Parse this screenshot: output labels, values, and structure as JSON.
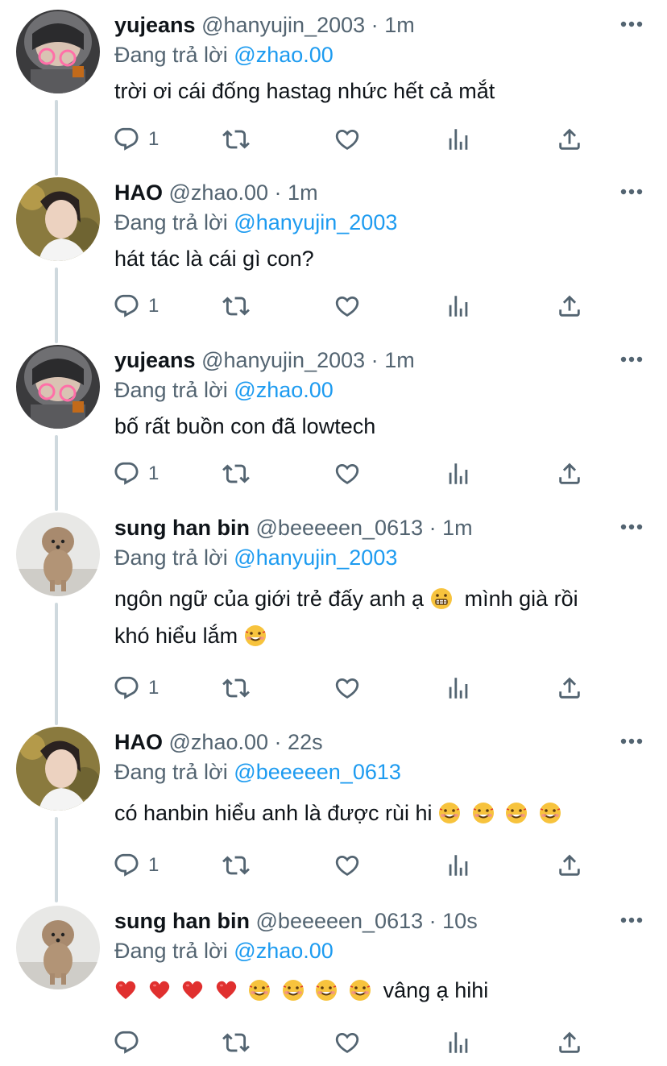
{
  "tweets": [
    {
      "name": "yujeans",
      "handle": "@hanyujin_2003",
      "dot": "·",
      "time": "1m",
      "reply_prefix": "Đang trả lời",
      "reply_to": "@zhao.00",
      "text": "trời ơi cái đống hastag nhức hết cả mắt",
      "reply_count": "1"
    },
    {
      "name": "HAO",
      "handle": "@zhao.00",
      "dot": "·",
      "time": "1m",
      "reply_prefix": "Đang trả lời",
      "reply_to": "@hanyujin_2003",
      "text": "hát tác là cái gì con?",
      "reply_count": "1"
    },
    {
      "name": "yujeans",
      "handle": "@hanyujin_2003",
      "dot": "·",
      "time": "1m",
      "reply_prefix": "Đang trả lời",
      "reply_to": "@zhao.00",
      "text": "bố rất buồn con đã lowtech",
      "reply_count": "1"
    },
    {
      "name": "sung han bin",
      "handle": "@beeeeen_0613",
      "dot": "·",
      "time": "1m",
      "reply_prefix": "Đang trả lời",
      "reply_to": "@hanyujin_2003",
      "text_part1": "ngôn ngữ của giới trẻ đấy anh ạ",
      "text_part2": "mình già rồi",
      "text_part3": "khó hiểu lắm",
      "reply_count": "1"
    },
    {
      "name": "HAO",
      "handle": "@zhao.00",
      "dot": "·",
      "time": "22s",
      "reply_prefix": "Đang trả lời",
      "reply_to": "@beeeeen_0613",
      "text": "có hanbin hiểu anh là được rùi hi",
      "reply_count": "1"
    },
    {
      "name": "sung han bin",
      "handle": "@beeeeen_0613",
      "dot": "·",
      "time": "10s",
      "reply_prefix": "Đang trả lời",
      "reply_to": "@zhao.00",
      "text": "vâng ạ hihi",
      "reply_count": ""
    }
  ],
  "icons": {
    "reply": "reply-icon",
    "retweet": "retweet-icon",
    "like": "heart-icon",
    "views": "views-icon",
    "share": "share-icon",
    "more": "more-icon"
  },
  "colors": {
    "link": "#1d9bf0",
    "secondary": "#536471",
    "thread_line": "#cfd9de"
  }
}
